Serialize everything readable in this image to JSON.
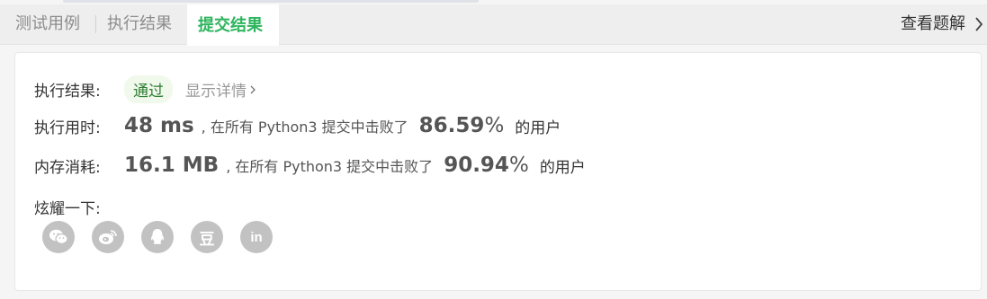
{
  "tabs": [
    {
      "label": "测试用例"
    },
    {
      "label": "执行结果"
    },
    {
      "label": "提交结果",
      "active": true
    }
  ],
  "solution_link": {
    "label": "查看题解",
    "icon": "chevron-right-icon"
  },
  "result": {
    "label": "执行结果:",
    "status": "通过",
    "details_label": "显示详情",
    "status_color": "#2e7d32",
    "status_bg": "#f0f9eb"
  },
  "runtime": {
    "label": "执行用时:",
    "value": "48 ms",
    "beat_text": ", 在所有 Python3 提交中击败了",
    "percent": "86.59",
    "percent_sign": "%",
    "suffix": "的用户"
  },
  "memory": {
    "label": "内存消耗:",
    "value": "16.1 MB",
    "beat_text": ", 在所有 Python3 提交中击败了",
    "percent": "90.94",
    "percent_sign": "%",
    "suffix": "的用户"
  },
  "share": {
    "label": "炫耀一下:",
    "buttons": [
      {
        "icon": "wechat-icon"
      },
      {
        "icon": "weibo-icon"
      },
      {
        "icon": "qq-icon"
      },
      {
        "icon": "douban-icon",
        "glyph": "豆"
      },
      {
        "icon": "linkedin-icon",
        "glyph": "in"
      }
    ]
  },
  "accent_color": "#2db55d"
}
